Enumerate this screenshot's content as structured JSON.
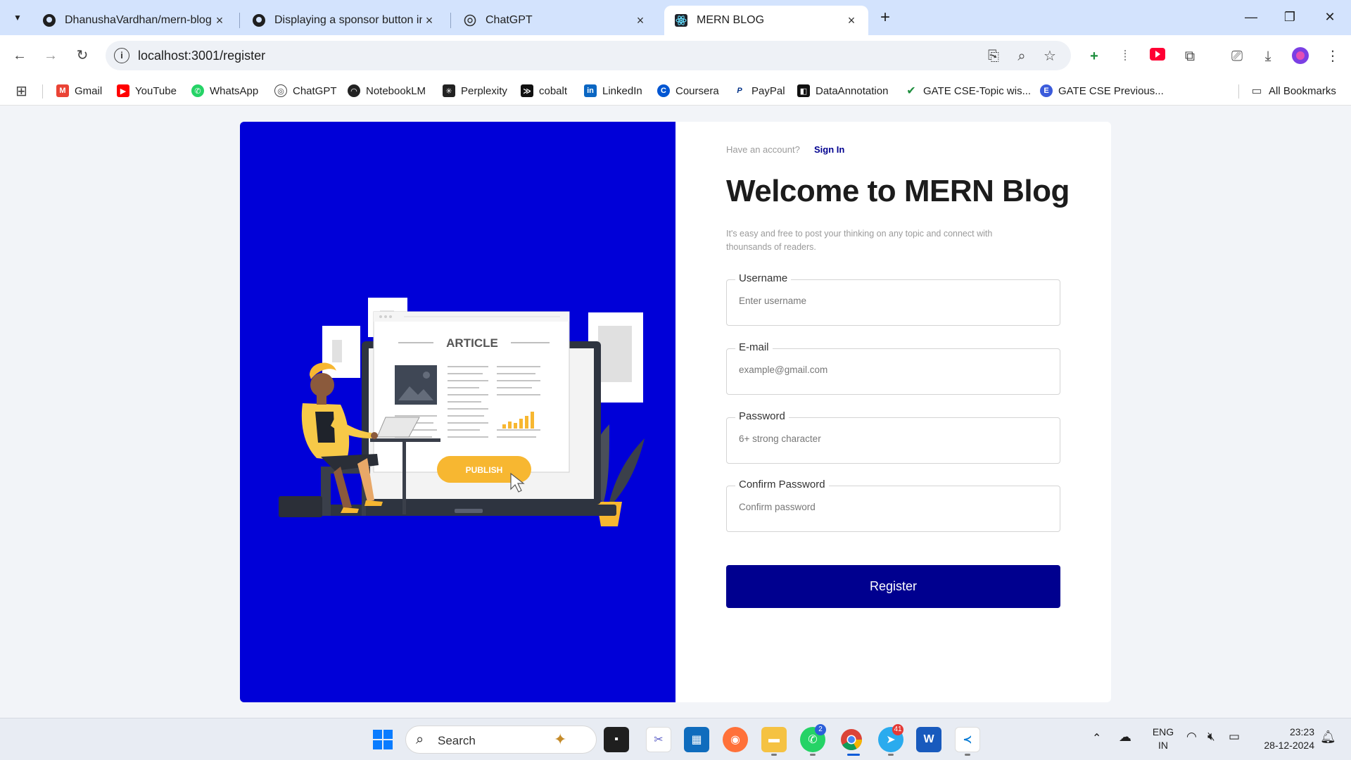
{
  "browser": {
    "tabs": [
      {
        "title": "DhanushaVardhan/mern-blog",
        "icon": "github-icon"
      },
      {
        "title": "Displaying a sponsor button in",
        "icon": "github-icon"
      },
      {
        "title": "ChatGPT",
        "icon": "chatgpt-icon"
      },
      {
        "title": "MERN BLOG",
        "icon": "react-icon"
      }
    ],
    "url": "localhost:3001/register",
    "bookmarks": [
      {
        "label": "Gmail",
        "color": "#ea4335"
      },
      {
        "label": "YouTube",
        "color": "#ff0000"
      },
      {
        "label": "WhatsApp",
        "color": "#25d366"
      },
      {
        "label": "ChatGPT",
        "color": "#444444"
      },
      {
        "label": "NotebookLM",
        "color": "#222222"
      },
      {
        "label": "Perplexity",
        "color": "#222222"
      },
      {
        "label": "cobalt",
        "color": "#111111"
      },
      {
        "label": "LinkedIn",
        "color": "#0a66c2"
      },
      {
        "label": "Coursera",
        "color": "#0056d2"
      },
      {
        "label": "PayPal",
        "color": "#003087"
      },
      {
        "label": "DataAnnotation",
        "color": "#111111"
      },
      {
        "label": "GATE CSE-Topic wis...",
        "color": "#1e8e3e"
      },
      {
        "label": "GATE CSE Previous...",
        "color": "#3b5bdb"
      }
    ],
    "all_bookmarks": "All Bookmarks"
  },
  "hero": {
    "article_label": "ARTICLE",
    "publish_label": "PUBLISH",
    "bg_color": "#0000d8"
  },
  "form": {
    "have_account": "Have an account?",
    "sign_in": "Sign In",
    "title": "Welcome to MERN Blog",
    "description": "It's easy and free to post your thinking on any topic and connect with thounsands of readers.",
    "fields": {
      "username": {
        "label": "Username",
        "placeholder": "Enter username"
      },
      "email": {
        "label": "E-mail",
        "placeholder": "example@gmail.com"
      },
      "password": {
        "label": "Password",
        "placeholder": "6+ strong character"
      },
      "confirm": {
        "label": "Confirm Password",
        "placeholder": "Confirm password"
      }
    },
    "register_label": "Register",
    "accent_color": "#00008f"
  },
  "taskbar": {
    "search_label": "Search",
    "whatsapp_badge": "2",
    "telegram_badge": "41",
    "lang": "ENG",
    "region": "IN",
    "time": "23:23",
    "date": "28-12-2024"
  }
}
